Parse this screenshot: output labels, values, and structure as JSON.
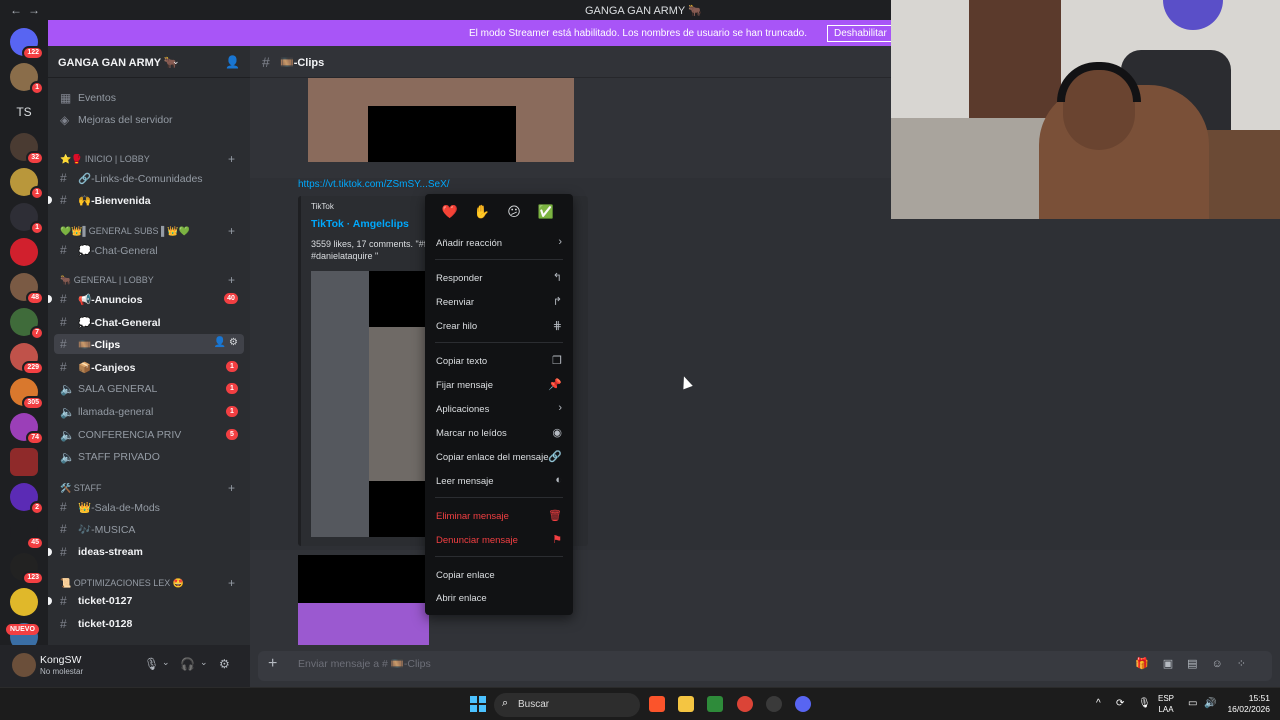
{
  "window": {
    "title": "GANGA GAN ARMY 🐂",
    "nav": "←→"
  },
  "banner": {
    "text": "El modo Streamer está habilitado. Los nombres de usuario se han truncado.",
    "button": "Deshabilitar"
  },
  "servers": {
    "items": [
      {
        "badge": "122"
      },
      {
        "badge": "1"
      },
      {
        "label": "TS"
      },
      {
        "badge": "32"
      },
      {
        "badge": "1"
      },
      {
        "badge": "1"
      },
      {
        "badge": ""
      },
      {
        "badge": "48"
      },
      {
        "badge": "7"
      },
      {
        "badge": "229"
      },
      {
        "badge": "305"
      },
      {
        "badge": "74"
      },
      {
        "badge": ""
      },
      {
        "badge": "2"
      },
      {
        "badge": "45"
      },
      {
        "badge": "123"
      },
      {
        "badge": ""
      },
      {
        "badge": ""
      }
    ],
    "nuevo": "NUEVO"
  },
  "sidebar": {
    "server_name": "GANGA GAN ARMY 🐂",
    "top_items": [
      {
        "label": "Eventos"
      },
      {
        "label": "Mejoras del servidor"
      }
    ],
    "categories": {
      "inicio": "⭐🥊 INICIO | LOBBY",
      "subs": "💚👑▌GENERAL SUBS ▌👑💚",
      "general": "🐂 GENERAL | LOBBY",
      "staff": "🛠️ STAFF",
      "optim": "📜 OPTIMIZACIONES LEX 🤩"
    },
    "channels": {
      "links": "🔗-Links-de-Comunidades",
      "bienvenida": "🙌-Bienvenida",
      "chat_subs": "💭-Chat-General",
      "anuncios": "📢-Anuncios",
      "anuncios_count": "40",
      "chat_general": "💭-Chat-General",
      "clips": "🎞️-Clips",
      "canjeos": "📦-Canjeos",
      "canjeos_count": "1",
      "sala_general": "SALA GENERAL",
      "sala_general_count": "1",
      "llamada": "llamada-general",
      "llamada_count": "1",
      "conferencia": "CONFERENCIA PRIV",
      "conferencia_count": "5",
      "staff_privado": "STAFF PRIVADO",
      "sala_mods": "👑-Sala-de-Mods",
      "musica": "🎶-MUSICA",
      "ideas": "ideas-stream",
      "ticket1": "ticket-0127",
      "ticket2": "ticket-0128"
    }
  },
  "user": {
    "name": "KongSW",
    "status": "No molestar"
  },
  "channel_header": {
    "name": "🎞️-Clips"
  },
  "message": {
    "link": "https://vt.tiktok.com/ZSmSY...SeX/",
    "embed_provider": "TikTok",
    "embed_title": "TikTok · Amgelclips",
    "embed_desc": "3559 likes, 17 comments. \"#fy #danielataquire \""
  },
  "composer": {
    "placeholder": "Enviar mensaje a # 🎞️-Clips"
  },
  "context_menu": {
    "reactions": [
      "❤️",
      "✋",
      "😕",
      "✅"
    ],
    "items": {
      "add_reaction": "Añadir reacción",
      "reply": "Responder",
      "forward": "Reenviar",
      "thread": "Crear hilo",
      "copy_text": "Copiar texto",
      "pin": "Fijar mensaje",
      "apps": "Aplicaciones",
      "mark_unread": "Marcar no leídos",
      "copy_msg_link": "Copiar enlace del mensaje",
      "read_msg": "Leer mensaje",
      "delete": "Eliminar mensaje",
      "report": "Denunciar mensaje",
      "copy_link": "Copiar enlace",
      "open_link": "Abrir enlace"
    }
  },
  "taskbar": {
    "search": "Buscar",
    "lang1": "ESP",
    "lang2": "LAA",
    "time": "15:51",
    "date": "16/02/2026"
  },
  "colors": {
    "accent": "#5865f2",
    "banner": "#a855f7",
    "danger": "#f23f42",
    "link": "#00a8fc"
  }
}
